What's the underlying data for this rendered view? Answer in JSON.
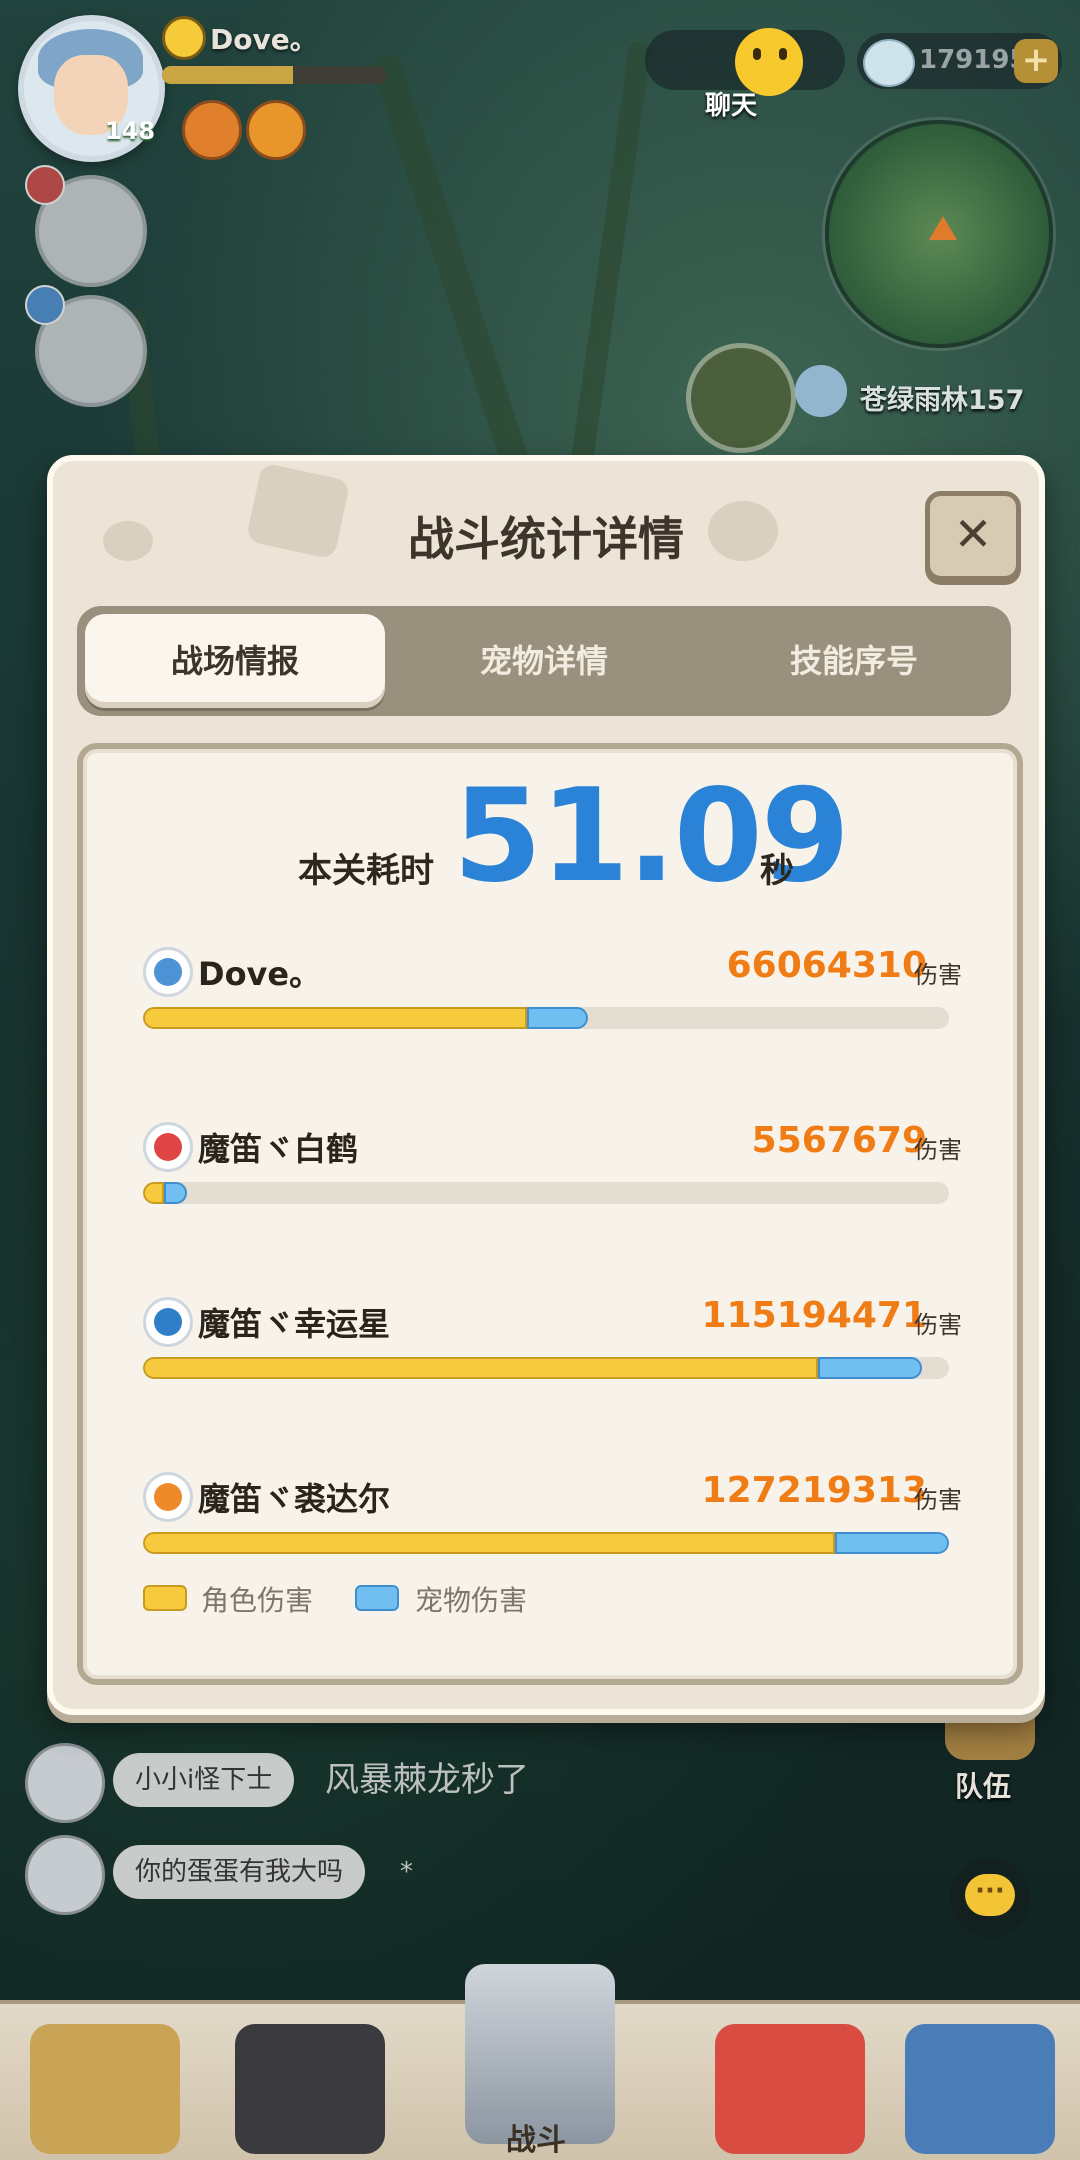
{
  "hud": {
    "player_name": "Dove。",
    "level": "148",
    "currency": "179195",
    "chat_label": "聊天",
    "zone_name": "苍绿雨林157"
  },
  "chat": {
    "lines": [
      {
        "user": "小小i怪下士",
        "message": "风暴棘龙秒了"
      },
      {
        "user": "你的蛋蛋有我大吗",
        "message": "*"
      }
    ]
  },
  "team_label": "队伍",
  "bottom_nav": {
    "battle_label": "战斗"
  },
  "modal": {
    "title": "战斗统计详情",
    "close_icon": "close-icon",
    "tabs": [
      "战场情报",
      "宠物详情",
      "技能序号"
    ],
    "time_label": "本关耗时",
    "time_value": "51.09",
    "time_unit": "秒",
    "damage_unit": "伤害",
    "players": [
      {
        "name": "Dove。",
        "damage": "66064310",
        "role_fraction": 0.477,
        "pet_fraction": 0.075,
        "element": "water"
      },
      {
        "name": "魔笛ヾ白鹤",
        "damage": "5567679",
        "role_fraction": 0.026,
        "pet_fraction": 0.029,
        "element": "fire"
      },
      {
        "name": "魔笛ヾ幸运星",
        "damage": "115194471",
        "role_fraction": 0.838,
        "pet_fraction": 0.129,
        "element": "grass"
      },
      {
        "name": "魔笛ヾ裘达尔",
        "damage": "127219313",
        "role_fraction": 0.858,
        "pet_fraction": 0.142,
        "element": "light"
      }
    ],
    "legend": {
      "role": "角色伤害",
      "pet": "宠物伤害",
      "role_color": "#f7c93c",
      "pet_color": "#71bff0"
    }
  }
}
